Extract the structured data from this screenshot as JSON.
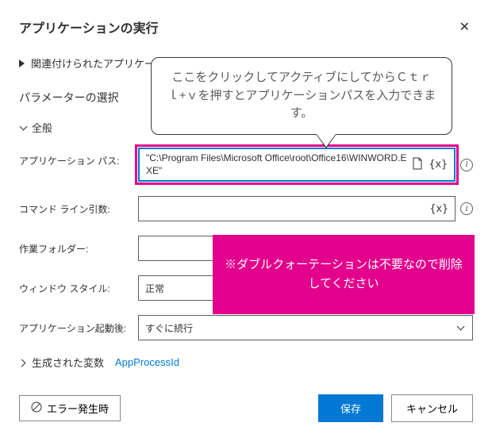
{
  "header": {
    "title": "アプリケーションの実行"
  },
  "linked_apps": {
    "label": "関連付けられたアプリケーションを"
  },
  "section": {
    "title": "パラメーターの選択",
    "general": "全般"
  },
  "fields": {
    "app_path": {
      "label": "アプリケーション パス:",
      "value": "\"C:\\Program Files\\Microsoft Office\\root\\Office16\\WINWORD.EXE\""
    },
    "cmd_args": {
      "label": "コマンド ライン引数:",
      "value": ""
    },
    "work_folder": {
      "label": "作業フォルダー:",
      "value": ""
    },
    "window_style": {
      "label": "ウィンドウ スタイル:",
      "value": "正常"
    },
    "after_launch": {
      "label": "アプリケーション起動後:",
      "value": "すぐに続行"
    }
  },
  "generated_vars": {
    "label": "生成された変数",
    "value": "AppProcessId"
  },
  "footer": {
    "error": "エラー発生時",
    "save": "保存",
    "cancel": "キャンセル"
  },
  "callout": {
    "text": "ここをクリックしてアクティブにしてからＣｔｒｌ+ｖを押すとアプリケーションパスを入力できます。"
  },
  "note": {
    "text": "※ダブルクォーテーションは不要なので削除してください"
  },
  "icons": {
    "var": "{x}"
  }
}
